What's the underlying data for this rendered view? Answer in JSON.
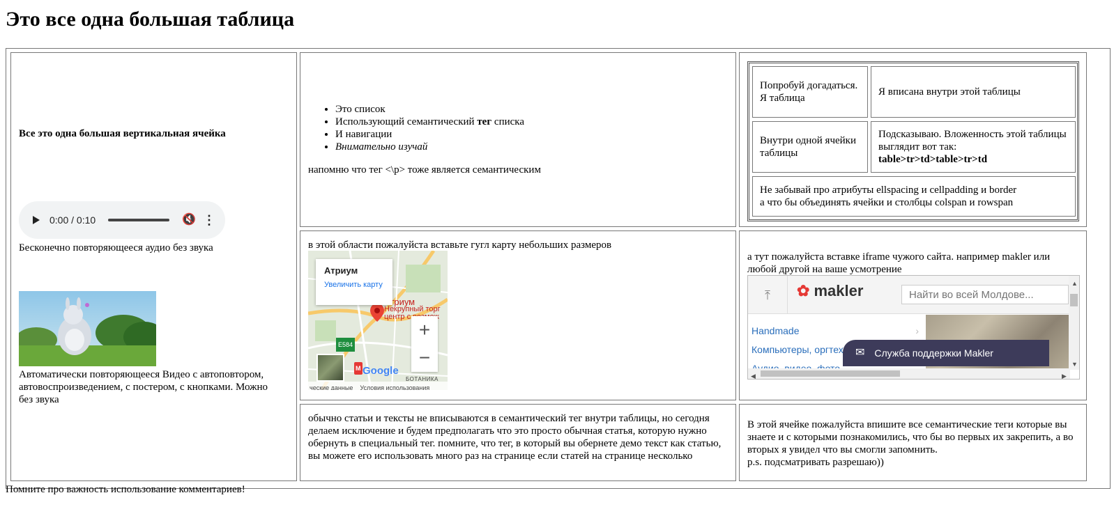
{
  "page": {
    "title": "Это все одна большая таблица",
    "footer": "Помните про важность использование комментариев!"
  },
  "cell1": {
    "title": "Все это одна большая вертикальная ячейка",
    "audio_time": "0:00 / 0:10",
    "audio_caption": "Бесконечно повторяющееся аудио без звука",
    "video_caption": "Автоматически повторяющееся Видео с автоповтором, автовоспроизведением, с постером, с кнопками. Можно без звука"
  },
  "cell2": {
    "list": [
      "Это список",
      "Использующий семантический ",
      "тег",
      " списка",
      "И навигации",
      "Внимательно изучай"
    ],
    "reminder": "напомню что тег <\\p> тоже является семантическим"
  },
  "nested": {
    "c1": "Попробуй догадаться. Я таблица",
    "c2": "Я вписана внутри этой таблицы",
    "c3": "Внутри одной ячейки таблицы",
    "c4_text": "Подсказываю. Вложенность этой таблицы выглядит вот так:",
    "c4_bold": "table>tr>td>table>tr>td",
    "c5_line1": "Не забывай про атрибуты ellspacing и cellpadding и border",
    "c5_line2": "а что бы объединять ячейки и столбцы colspan и rowspan"
  },
  "map": {
    "note": "в этой области пожалуйста вставьте гугл карту небольших размеров",
    "popup_title": "Атриум",
    "popup_link": "Увеличить карту",
    "pin_title": "Атриум",
    "pin_sub1": "Некрупный торг",
    "pin_sub2": "центр с возмож",
    "road": "E584",
    "metro": "M",
    "google": "Google",
    "district": "БОТАНИКА",
    "attr1": "ческие данные",
    "attr2": "Условия использования"
  },
  "iframe": {
    "note": "а тут пожалуйста вставке iframe чужого сайта. например makler или любой другой на ваше усмотрение",
    "logo": "makler",
    "search_placeholder": "Найти во всей Молдове...",
    "categories": [
      "Handmade",
      "Компьютеры, оргтех",
      "Аудио, видео, фото"
    ],
    "support": "Служба поддержки Makler"
  },
  "cell6": {
    "text": "обычно статьи и тексты не вписываются в семантический тег внутри таблицы, но сегодня делаем исключение и будем предполагать что это просто обычная статья, которую нужно обернуть в специальный тег. помните, что тег, в который вы обернете демо текст как статью, вы можете его использовать много раз на странице если статей на странице несколько"
  },
  "cell7": {
    "line1": "В этой ячейке пожалуйста впишите все семантические теги которые вы знаете и с которыми познакомились, что бы во первых их закрепить, а во вторых я увидел что вы смогли запомнить.",
    "line2": "p.s. подсматривать разрешаю))"
  }
}
